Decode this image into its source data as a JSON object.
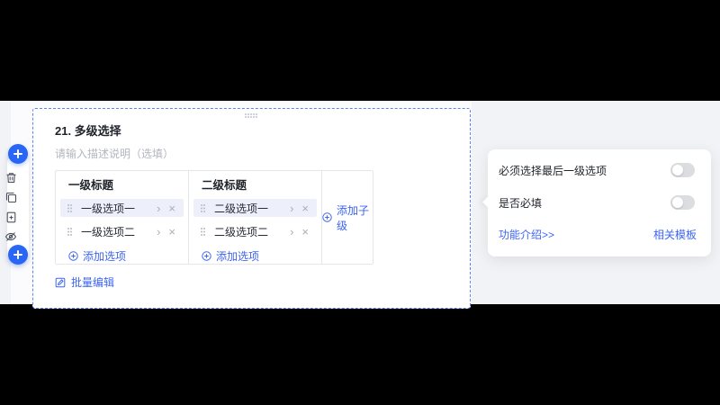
{
  "colors": {
    "accent_blue": "#3d65f2",
    "plus_button_blue": "#2a66f5",
    "dashed_border_blue": "#5b84f4",
    "selected_row_bg": "#edf0fa",
    "band_bg": "#f2f3f6"
  },
  "icons": {
    "chevron_right": "›",
    "close": "×"
  },
  "toolbar": {
    "items": [
      "add-question-top",
      "delete",
      "copy",
      "save-as-template",
      "hide",
      "add-question-bottom"
    ]
  },
  "question": {
    "number_title": "21. 多级选择",
    "description_placeholder": "请输入描述说明（选填）",
    "table": {
      "columns": [
        {
          "header": "一级标题",
          "options": [
            {
              "label": "一级选项一",
              "selected": true
            },
            {
              "label": "一级选项二",
              "selected": false
            }
          ],
          "add_label": "添加选项"
        },
        {
          "header": "二级标题",
          "options": [
            {
              "label": "二级选项一",
              "selected": true
            },
            {
              "label": "二级选项二",
              "selected": false
            }
          ],
          "add_label": "添加选项"
        }
      ],
      "add_child_label": "添加子级"
    },
    "batch_edit_label": "批量编辑"
  },
  "settings": {
    "toggles": [
      {
        "label": "必须选择最后一级选项",
        "on": false
      },
      {
        "label": "是否必填",
        "on": false
      }
    ],
    "feature_link": "功能介绍>>",
    "template_link": "相关模板"
  }
}
